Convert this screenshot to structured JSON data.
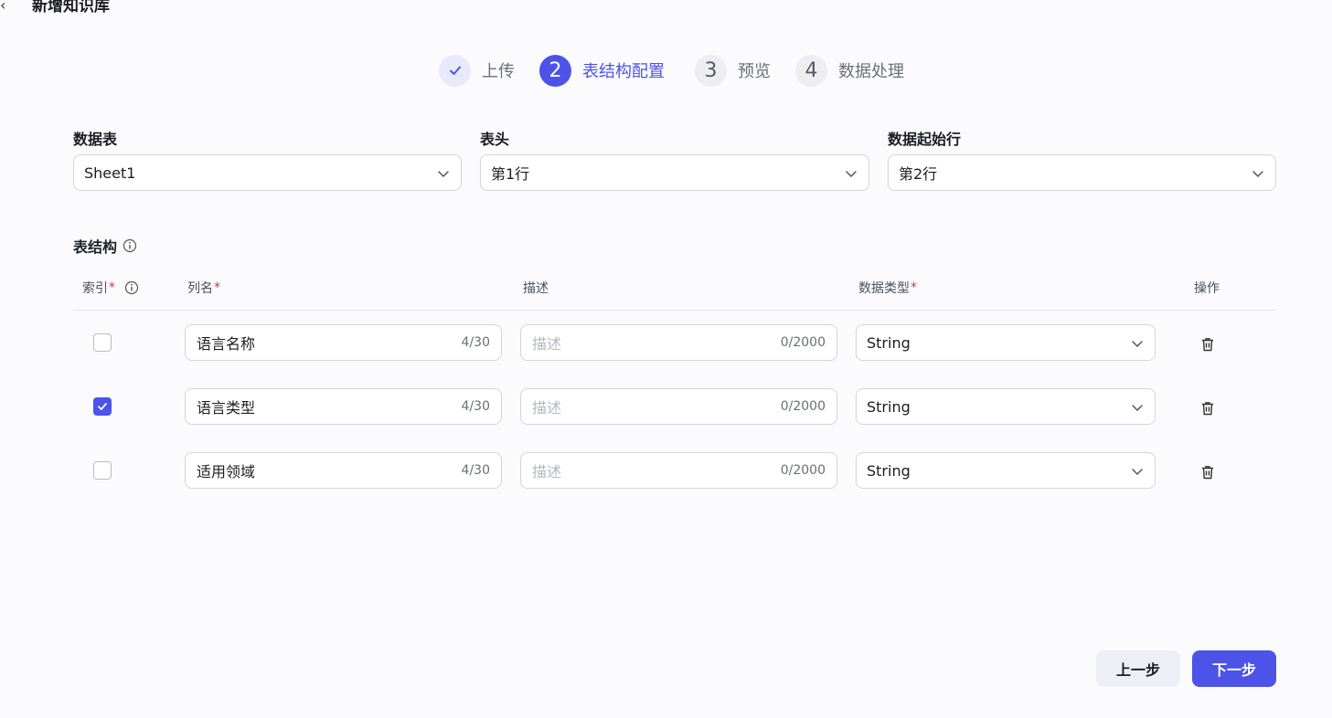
{
  "header": {
    "back_icon": "‹",
    "title": "新增知识库"
  },
  "steps": [
    {
      "label": "上传",
      "status": "done",
      "icon": "check-icon"
    },
    {
      "label": "表结构配置",
      "status": "active",
      "number": "2"
    },
    {
      "label": "预览",
      "status": "todo",
      "number": "3"
    },
    {
      "label": "数据处理",
      "status": "todo",
      "number": "4"
    }
  ],
  "config": {
    "sheet": {
      "label": "数据表",
      "value": "Sheet1"
    },
    "header_row": {
      "label": "表头",
      "value": "第1行"
    },
    "start_row": {
      "label": "数据起始行",
      "value": "第2行"
    }
  },
  "table": {
    "title": "表结构",
    "columns": {
      "index": "索引",
      "name": "列名",
      "desc": "描述",
      "type": "数据类型",
      "action": "操作",
      "required_mark": "*"
    },
    "rows": [
      {
        "indexed": false,
        "name": "语言名称",
        "name_count": "4/30",
        "desc_placeholder": "描述",
        "desc_count": "0/2000",
        "type": "String"
      },
      {
        "indexed": true,
        "name": "语言类型",
        "name_count": "4/30",
        "desc_placeholder": "描述",
        "desc_count": "0/2000",
        "type": "String"
      },
      {
        "indexed": false,
        "name": "适用领域",
        "name_count": "4/30",
        "desc_placeholder": "描述",
        "desc_count": "0/2000",
        "type": "String"
      }
    ]
  },
  "footer": {
    "prev_label": "上一步",
    "next_label": "下一步"
  },
  "colors": {
    "accent": "#4d53e8",
    "required": "#e0323c"
  }
}
